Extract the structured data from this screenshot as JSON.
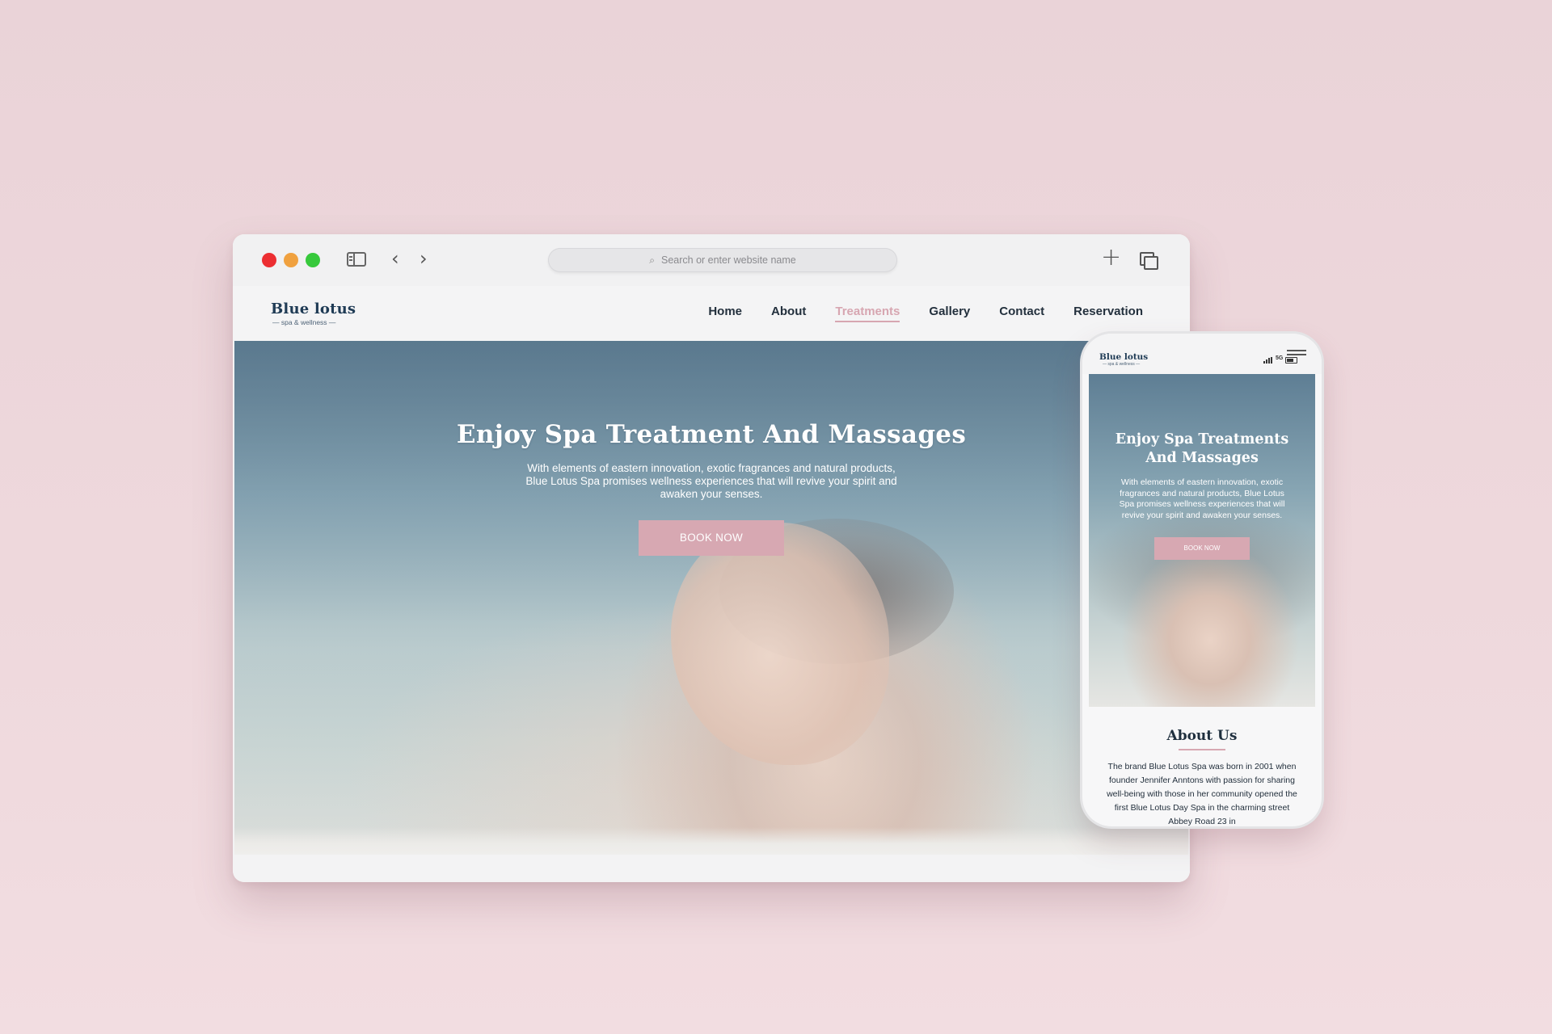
{
  "browser": {
    "address_placeholder": "Search or enter website name",
    "icons": {
      "close": "close-dot",
      "minimize": "minimize-dot",
      "maximize": "maximize-dot",
      "sidebar": "sidebar-icon",
      "back": "chevron-left-icon",
      "forward": "chevron-right-icon",
      "search": "search-icon",
      "new_tab": "plus-icon",
      "tabs": "tabs-icon"
    },
    "back_glyph": "‹",
    "forward_glyph": "›",
    "plus_glyph": "+",
    "search_glyph": "⌕"
  },
  "site": {
    "logo": {
      "name": "Blue lotus",
      "tagline": "— spa & wellness —"
    },
    "nav": [
      {
        "label": "Home",
        "active": false
      },
      {
        "label": "About",
        "active": false
      },
      {
        "label": "Treatments",
        "active": true
      },
      {
        "label": "Gallery",
        "active": false
      },
      {
        "label": "Contact",
        "active": false
      },
      {
        "label": "Reservation",
        "active": false
      }
    ],
    "hero": {
      "title": "Enjoy Spa Treatment And Massages",
      "description": "With elements of eastern innovation, exotic fragrances and natural products, Blue Lotus Spa promises wellness experiences that will revive your spirit and awaken your senses.",
      "button": "BOOK NOW"
    }
  },
  "phone": {
    "logo": {
      "name": "Blue lotus",
      "tagline": "— spa & wellness —"
    },
    "network": "5G",
    "hero": {
      "title": "Enjoy Spa Treatments And Massages",
      "description": "With elements of eastern innovation, exotic fragrances and natural products, Blue Lotus Spa promises wellness experiences that will revive your spirit and awaken your senses.",
      "button": "BOOK NOW"
    },
    "about": {
      "title": "About Us",
      "text": "The brand Blue Lotus Spa was born in 2001 when founder Jennifer Anntons with passion for sharing well-being with those in her community opened the first Blue Lotus Day Spa in the charming street Abbey Road 23 in"
    }
  },
  "colors": {
    "background": "#ead3d8",
    "accent_pink": "#d7a8b2",
    "navy": "#1f3b55",
    "traffic_red": "#ec2e32",
    "traffic_yellow": "#f0a13f",
    "traffic_green": "#37c93c"
  }
}
